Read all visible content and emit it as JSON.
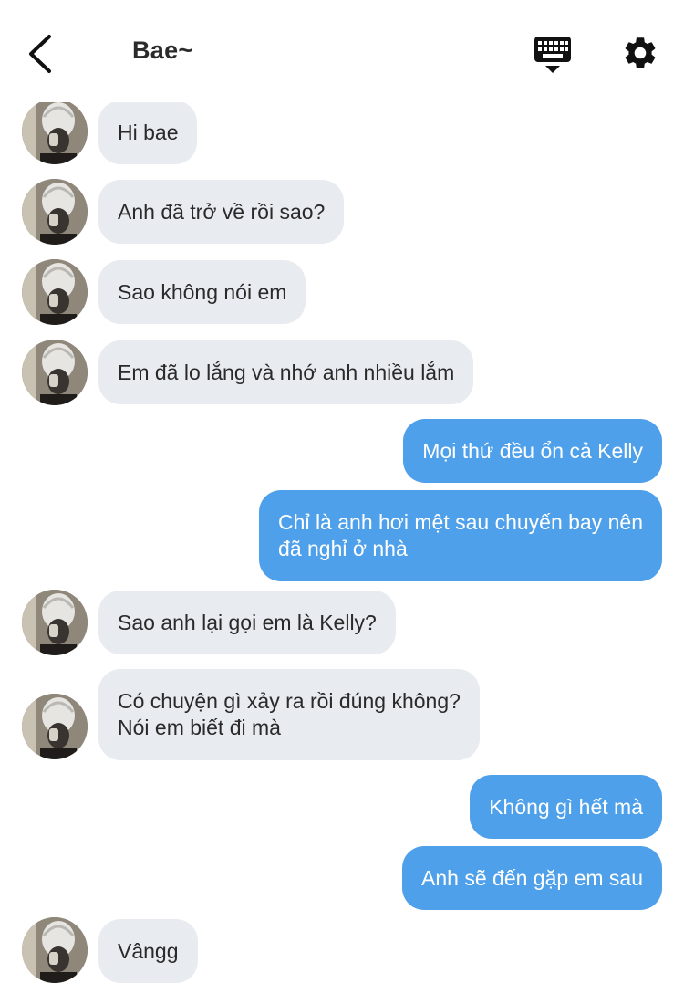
{
  "header": {
    "title": "Bae~",
    "back_icon": "back-chevron-icon",
    "keyboard_icon": "keyboard-icon",
    "settings_icon": "gear-icon"
  },
  "colors": {
    "incoming_bubble": "#e8ebef",
    "outgoing_bubble": "#4fa0ea",
    "icon": "#111111"
  },
  "messages": [
    {
      "from": "them",
      "text": "Hi bae"
    },
    {
      "from": "them",
      "text": "Anh đã trở về rồi sao?"
    },
    {
      "from": "them",
      "text": "Sao không nói em"
    },
    {
      "from": "them",
      "text": "Em đã lo lắng và nhớ anh nhiều lắm"
    },
    {
      "from": "me",
      "text": "Mọi thứ đều ổn cả Kelly"
    },
    {
      "from": "me",
      "text": "Chỉ là anh hơi mệt sau chuyến bay nên\nđã nghỉ ở nhà"
    },
    {
      "from": "them",
      "text": "Sao anh lại gọi em là Kelly?"
    },
    {
      "from": "them",
      "text": "Có chuyện gì xảy ra rồi đúng không?\nNói em biết đi mà"
    },
    {
      "from": "me",
      "text": "Không gì hết mà"
    },
    {
      "from": "me",
      "text": "Anh sẽ đến gặp em sau"
    },
    {
      "from": "them",
      "text": "Vângg"
    }
  ]
}
